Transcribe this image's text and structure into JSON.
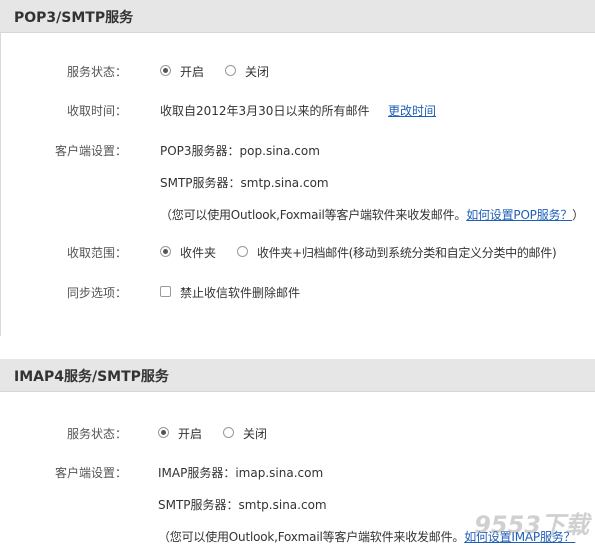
{
  "pop3": {
    "title": "POP3/SMTP服务",
    "status_label": "服务状态：",
    "status_options": [
      "开启",
      "关闭"
    ],
    "status_selected": "开启",
    "receive_time_label": "收取时间：",
    "receive_time_text": "收取自2012年3月30日以来的所有邮件",
    "change_time_link": "更改时间",
    "client_label": "客户端设置：",
    "pop3_server": "POP3服务器：pop.sina.com",
    "smtp_server": "SMTP服务器：smtp.sina.com",
    "note_text": "（您可以使用Outlook,Foxmail等客户端软件来收发邮件。",
    "note_link": "如何设置POP服务？",
    "note_end": "）",
    "range_label": "收取范围：",
    "range_options": [
      "收件夹",
      "收件夹+归档邮件(移动到系统分类和自定义分类中的邮件)"
    ],
    "range_selected": "收件夹",
    "sync_label": "同步选项：",
    "sync_checkbox_label": "禁止收信软件删除邮件",
    "sync_checked": false
  },
  "imap": {
    "title": "IMAP4服务/SMTP服务",
    "status_label": "服务状态：",
    "status_options": [
      "开启",
      "关闭"
    ],
    "status_selected": "开启",
    "client_label": "客户端设置：",
    "imap_server": "IMAP服务器：imap.sina.com",
    "smtp_server": "SMTP服务器：smtp.sina.com",
    "note_text": "（您可以使用Outlook,Foxmail等客户端软件来收发邮件。",
    "note_link": "如何设置IMAP服务？"
  },
  "watermark": "9553下载",
  "colors": {
    "header_bg": "#e6e6e6",
    "link": "#1f5fb8",
    "text": "#333333"
  }
}
